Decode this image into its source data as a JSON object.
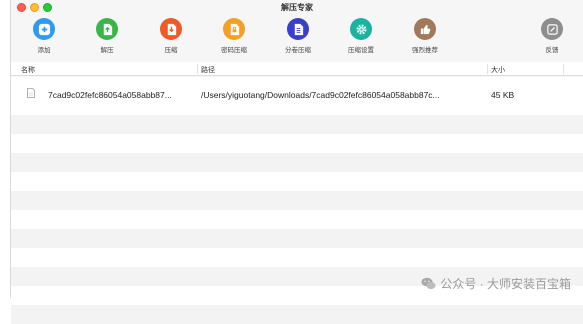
{
  "window": {
    "title": "解压专家"
  },
  "toolbar": {
    "items": [
      {
        "label": "添加",
        "color": "#2e9bf0",
        "icon": "plus-icon"
      },
      {
        "label": "解压",
        "color": "#3ab54a",
        "icon": "extract-icon"
      },
      {
        "label": "压缩",
        "color": "#f05a28",
        "icon": "compress-icon"
      },
      {
        "label": "密码压缩",
        "color": "#f5a023",
        "icon": "lock-icon"
      },
      {
        "label": "分卷压缩",
        "color": "#3a3fc8",
        "icon": "split-icon"
      },
      {
        "label": "压缩设置",
        "color": "#19b3a0",
        "icon": "gear-icon"
      },
      {
        "label": "强烈推荐",
        "color": "#a07a5a",
        "icon": "thumbs-up-icon"
      },
      {
        "label": "反馈",
        "color": "#8e8e8e",
        "icon": "feedback-icon"
      }
    ]
  },
  "table": {
    "columns": [
      "名称",
      "路径",
      "大小"
    ],
    "rows": [
      {
        "name": "7cad9c02fefc86054a058abb87...",
        "path": "/Users/yiguotang/Downloads/7cad9c02fefc86054a058abb87c...",
        "size": "45 KB"
      }
    ]
  },
  "watermark": {
    "text": "公众号 · 大师安装百宝箱"
  }
}
